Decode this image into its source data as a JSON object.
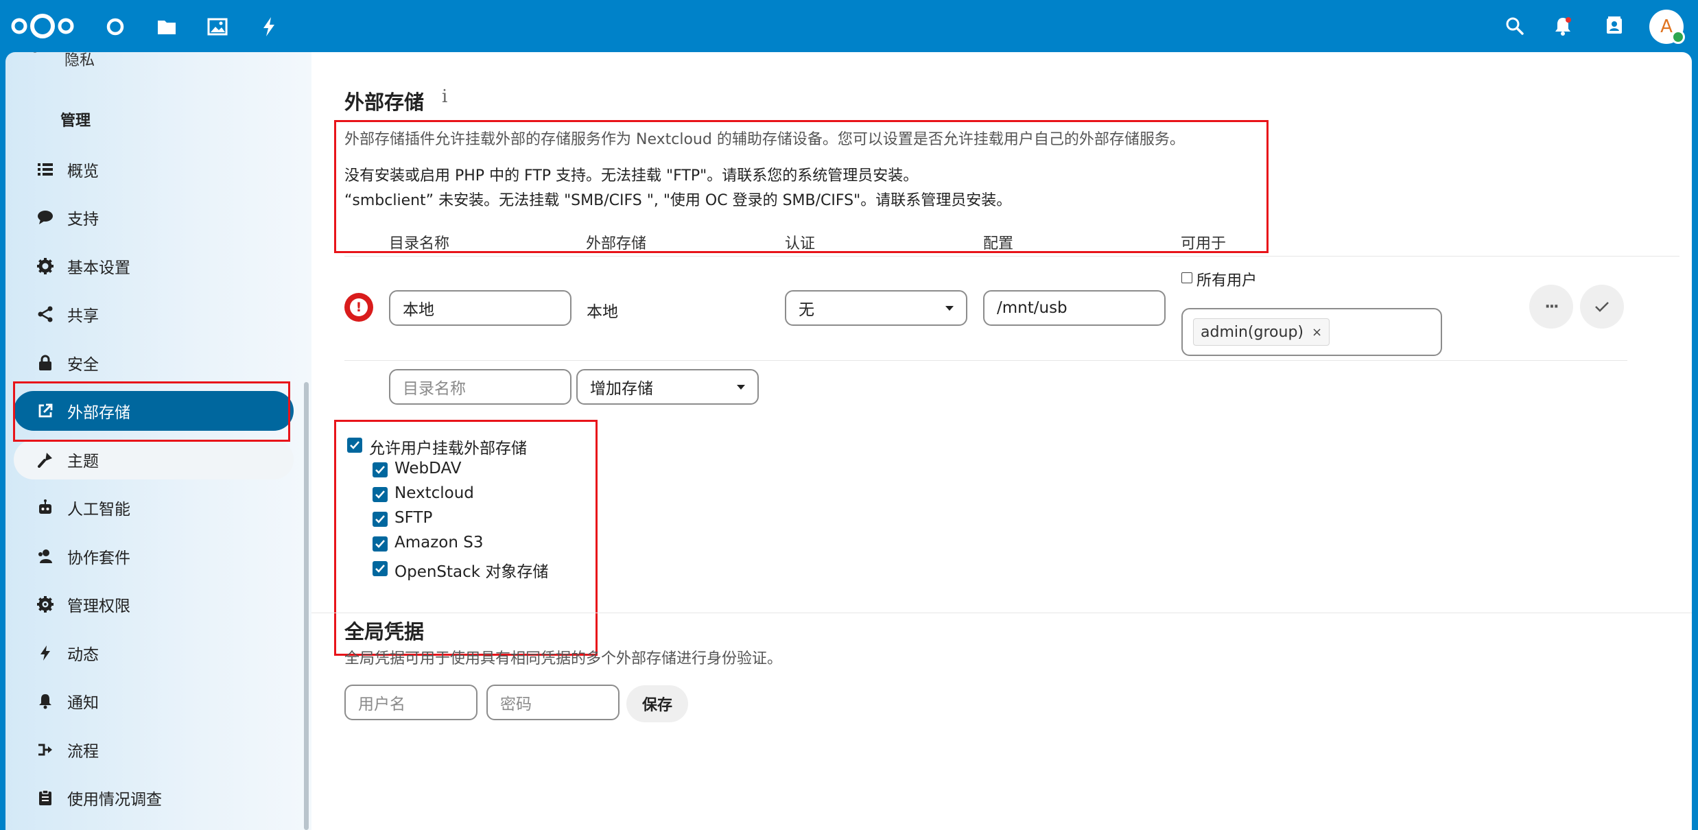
{
  "header": {
    "apps": [
      {
        "name": "dashboard",
        "icon": "circle-icon"
      },
      {
        "name": "files",
        "icon": "folder-icon"
      },
      {
        "name": "photos",
        "icon": "image-icon"
      },
      {
        "name": "activity",
        "icon": "bolt-icon"
      }
    ],
    "right": [
      "search-icon",
      "bell-icon",
      "contacts-icon"
    ],
    "avatar_letter": "A",
    "notification_dot_color": "#e9322d"
  },
  "sidebar": {
    "cut_item_label": "隐私",
    "section_title": "管理",
    "items": [
      {
        "label": "概览",
        "icon": "list-icon"
      },
      {
        "label": "支持",
        "icon": "speech-bubble-icon"
      },
      {
        "label": "基本设置",
        "icon": "gear-icon"
      },
      {
        "label": "共享",
        "icon": "share-icon"
      },
      {
        "label": "安全",
        "icon": "lock-icon"
      },
      {
        "label": "外部存储",
        "icon": "external-link-icon",
        "active": true
      },
      {
        "label": "主题",
        "icon": "paintbrush-icon"
      },
      {
        "label": "人工智能",
        "icon": "robot-icon"
      },
      {
        "label": "协作套件",
        "icon": "account-group-icon"
      },
      {
        "label": "管理权限",
        "icon": "admin-gear-icon"
      },
      {
        "label": "动态",
        "icon": "bolt-icon"
      },
      {
        "label": "通知",
        "icon": "bell-icon"
      },
      {
        "label": "流程",
        "icon": "flow-icon"
      },
      {
        "label": "使用情况调查",
        "icon": "clipboard-icon"
      }
    ]
  },
  "external_storage": {
    "title": "外部存储",
    "info_symbol": "i",
    "description": "外部存储插件允许挂载外部的存储服务作为 Nextcloud 的辅助存储设备。您可以设置是否允许挂载用户自己的外部存储服务。",
    "warnings": [
      "没有安装或启用 PHP 中的 FTP 支持。无法挂载 \"FTP\"。请联系您的系统管理员安装。",
      "“smbclient” 未安装。无法挂载 \"SMB/CIFS \", \"使用 OC 登录的 SMB/CIFS\"。请联系管理员安装。"
    ],
    "table": {
      "headers": [
        "目录名称",
        "外部存储",
        "认证",
        "配置",
        "可用于"
      ],
      "row": {
        "status_symbol": "!",
        "folder_name": "本地",
        "backend": "本地",
        "auth": "无",
        "config": "/mnt/usb",
        "all_users_label": "所有用户",
        "all_users_checked": false,
        "groups": [
          "admin(group)"
        ],
        "tag_remove": "×",
        "more_symbol": "···",
        "confirm_symbol": "✓"
      },
      "new_row": {
        "folder_placeholder": "目录名称",
        "add_storage_label": "增加存储"
      }
    },
    "user_mounting": {
      "label": "允许用户挂载外部存储",
      "checked": true,
      "backends": [
        {
          "label": "WebDAV",
          "checked": true
        },
        {
          "label": "Nextcloud",
          "checked": true
        },
        {
          "label": "SFTP",
          "checked": true
        },
        {
          "label": "Amazon S3",
          "checked": true
        },
        {
          "label": "OpenStack 对象存储",
          "checked": true
        }
      ]
    }
  },
  "global_credentials": {
    "title": "全局凭据",
    "description": "全局凭据可用于使用具有相同凭据的多个外部存储进行身份验证。",
    "username_placeholder": "用户名",
    "password_placeholder": "密码",
    "save_label": "保存"
  },
  "colors": {
    "header_blue": "#0082c9",
    "active_blue": "#00679e",
    "highlight_red": "#e8141a",
    "error_red": "#d91c1c"
  }
}
